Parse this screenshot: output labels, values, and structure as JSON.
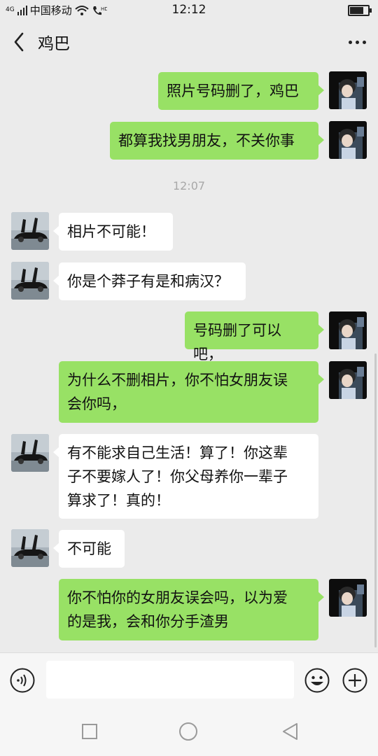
{
  "status_bar": {
    "carrier": "中国移动",
    "network": "4G",
    "time": "12:12",
    "battery_level": 0.7
  },
  "header": {
    "title": "鸡巴"
  },
  "messages": [
    {
      "side": "out",
      "text": "照片号码删了，鸡巴"
    },
    {
      "side": "out",
      "text": "都算我找男朋友，不关你事"
    },
    {
      "side": "in",
      "text": "相片不可能！"
    },
    {
      "side": "in",
      "text": "你是个莽子有是和病汉？"
    },
    {
      "side": "out",
      "text": "号码删了可以吧，"
    },
    {
      "side": "out",
      "lines": [
        "为什么不删相片，你不怕女朋友误",
        "会你吗，"
      ]
    },
    {
      "side": "in",
      "lines": [
        "有不能求自己生活！算了！你这辈",
        "子不要嫁人了！你父母养你一辈子",
        "算求了！真的！"
      ]
    },
    {
      "side": "in",
      "text": "不可能"
    },
    {
      "side": "out",
      "lines": [
        "你不怕你的女朋友误会吗，以为爱",
        "的是我，会和你分手渣男"
      ]
    }
  ],
  "timestamp": "12:07",
  "input": {
    "value": ""
  },
  "icons": {
    "back": "chevron-left-icon",
    "more": "more-dots-icon",
    "voice": "voice-icon",
    "emoji": "emoji-icon",
    "plus": "plus-icon",
    "nav_recents": "square-icon",
    "nav_home": "circle-icon",
    "nav_back": "triangle-back-icon"
  },
  "colors": {
    "outgoing_bubble": "#98e165",
    "incoming_bubble": "#ffffff",
    "background": "#ebebeb"
  }
}
